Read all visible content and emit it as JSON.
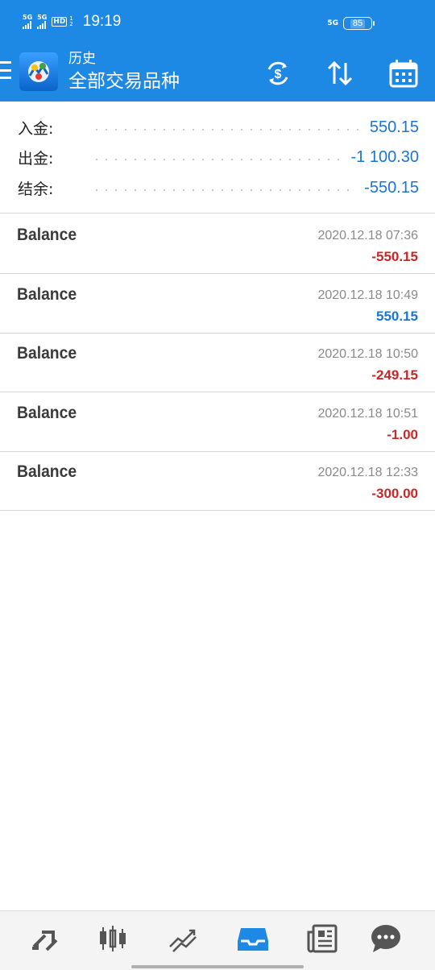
{
  "status_bar": {
    "sim1": "5G",
    "sim2": "5G",
    "hd": "HD",
    "hd_sub_top": "1",
    "hd_sub_bottom": "2",
    "time": "19:19",
    "network": "5G",
    "battery": "85"
  },
  "app_bar": {
    "title": "历史",
    "subtitle": "全部交易品种",
    "icons": [
      "currency-exchange-icon",
      "sort-icon",
      "calendar-icon"
    ]
  },
  "summary": [
    {
      "label": "入金:",
      "value": "550.15"
    },
    {
      "label": "出金:",
      "value": "-1 100.30"
    },
    {
      "label": "结余:",
      "value": "-550.15"
    }
  ],
  "deals": [
    {
      "name": "Balance",
      "date": "2020.12.18 07:36",
      "amount": "-550.15",
      "sign": "neg"
    },
    {
      "name": "Balance",
      "date": "2020.12.18 10:49",
      "amount": "550.15",
      "sign": "pos"
    },
    {
      "name": "Balance",
      "date": "2020.12.18 10:50",
      "amount": "-249.15",
      "sign": "neg"
    },
    {
      "name": "Balance",
      "date": "2020.12.18 10:51",
      "amount": "-1.00",
      "sign": "neg"
    },
    {
      "name": "Balance",
      "date": "2020.12.18 12:33",
      "amount": "-300.00",
      "sign": "neg"
    }
  ],
  "bottom_nav": {
    "items": [
      "quotes-icon",
      "chart-icon",
      "trade-icon",
      "history-icon",
      "news-icon",
      "chat-icon"
    ],
    "active": "history-icon",
    "colors": {
      "active": "#1e88e5",
      "inactive": "#555555"
    }
  },
  "colors": {
    "primary": "#1e88e5",
    "positive": "#1976d2",
    "negative": "#c62828"
  }
}
